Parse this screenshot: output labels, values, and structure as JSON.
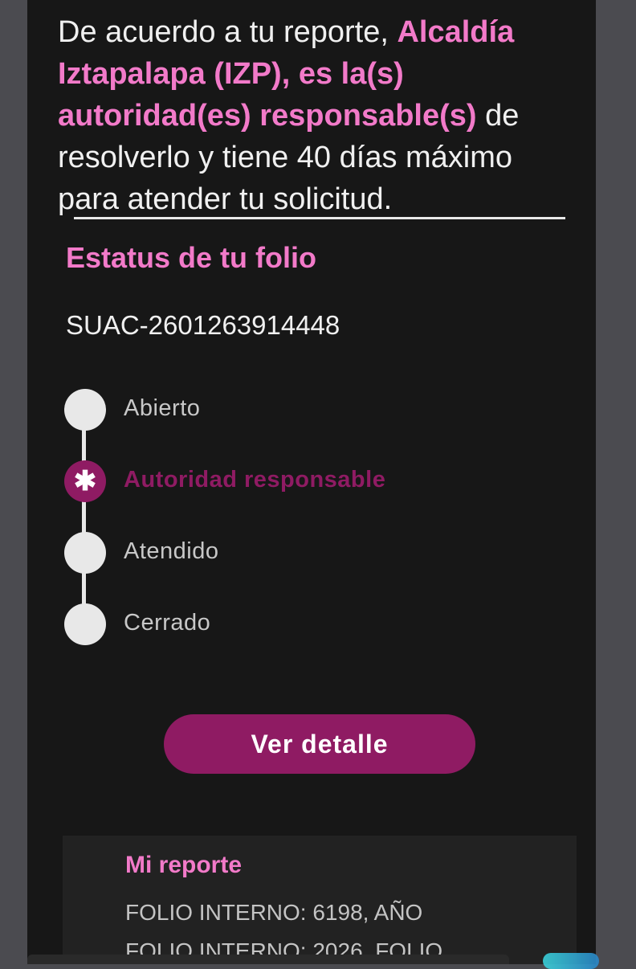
{
  "intro": {
    "part1": "De acuerdo a tu reporte, ",
    "highlight": "Alcaldía Iztapalapa (IZP), es la(s) autoridad(es) responsable(s)",
    "part2": " de resolverlo y tiene 40 días máximo para atender tu solicitud."
  },
  "status": {
    "title_prefix": "Estatus de tu ",
    "title_bold": "folio",
    "folio_id": "SUAC-2601263914448",
    "steps": [
      {
        "label": "Abierto",
        "state": "inactive"
      },
      {
        "label": "Autoridad responsable",
        "state": "active",
        "marker": "✱"
      },
      {
        "label": "Atendido",
        "state": "inactive"
      },
      {
        "label": "Cerrado",
        "state": "inactive"
      }
    ],
    "detail_button": "Ver detalle"
  },
  "report": {
    "title": "Mi reporte",
    "lines": [
      "FOLIO INTERNO: 6198, AÑO",
      "FOLIO INTERNO: 2026, FOLIO"
    ]
  },
  "colors": {
    "accent_pink": "#f27ac9",
    "accent_magenta": "#8f1b63",
    "background": "#171717",
    "rail": "#4b4b50"
  }
}
